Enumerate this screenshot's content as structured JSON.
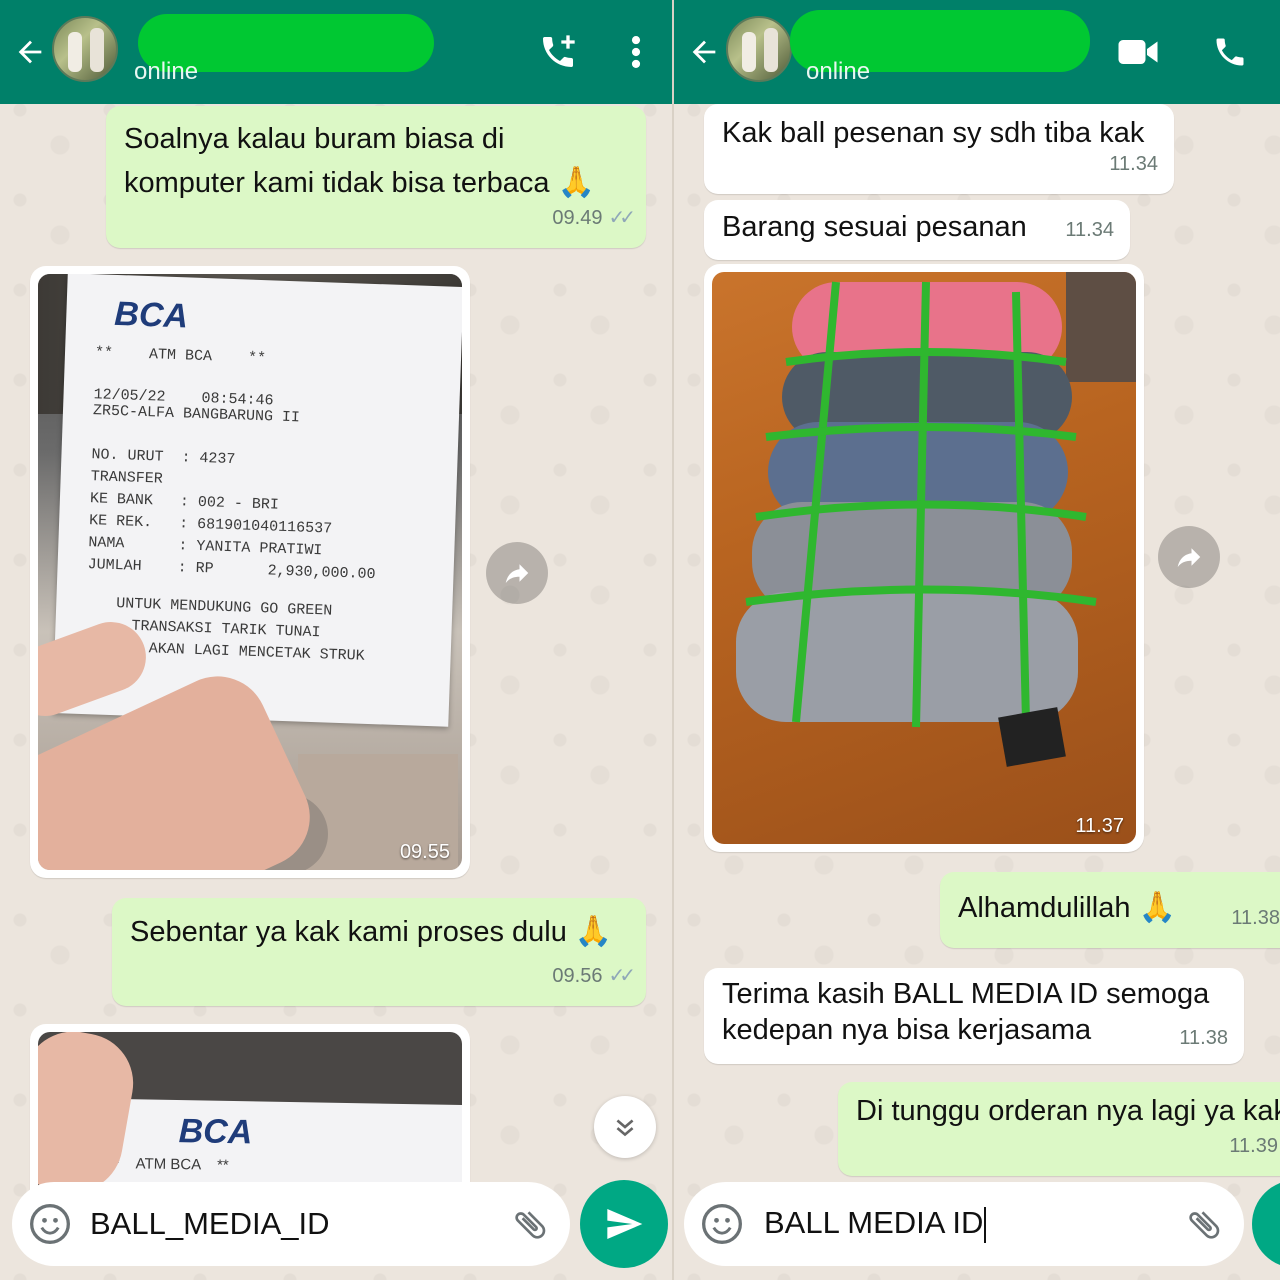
{
  "left": {
    "header": {
      "status": "online"
    },
    "messages": {
      "m1": {
        "text": "Soalnya kalau buram biasa di komputer kami tidak bisa terbaca",
        "emoji": "🙏",
        "time": "09.49"
      },
      "m2": {
        "time": "09.55"
      },
      "m3": {
        "text": "Sebentar ya kak kami proses dulu",
        "emoji": "🙏",
        "time": "09.56"
      }
    },
    "receipt": {
      "brand": "BCA",
      "lines": [
        "**    ATM BCA    **",
        "12/05/22    08:54:46",
        "ZR5C-ALFA BANGBARUNG II",
        "NO. URUT  : 4237",
        "TRANSFER",
        "KE BANK   : 002 - BRI",
        "KE REK.   : 681901040116537",
        "NAMA      : YANITA PRATIWI",
        "JUMLAH    : RP      2,930,000.00",
        "UNTUK MENDUKUNG GO GREEN",
        "TRANSAKSI TARIK TUNAI",
        "TIDAK AKAN LAGI MENCETAK STRUK"
      ]
    },
    "receipt2": {
      "brand": "BCA",
      "line": "**    ATM BCA    **"
    },
    "composer": {
      "text": "BALL_MEDIA_ID"
    }
  },
  "right": {
    "header": {
      "status": "online"
    },
    "messages": {
      "m1": {
        "text": "Kak ball pesenan sy sdh tiba kak",
        "time": "11.34"
      },
      "m2": {
        "text": "Barang sesuai pesanan",
        "time": "11.34"
      },
      "m3": {
        "time": "11.37"
      },
      "m4": {
        "text": "Alhamdulillah",
        "emoji": "🙏",
        "time": "11.38"
      },
      "m5": {
        "text": "Terima kasih BALL MEDIA ID semoga kedepan nya bisa kerjasama",
        "time": "11.38"
      },
      "m6": {
        "text": "Di tunggu orderan nya lagi ya kak",
        "time": "11.39"
      }
    },
    "composer": {
      "text": "BALL MEDIA ID"
    }
  },
  "colors": {
    "header": "#008069",
    "outgoing_bubble": "#dcf8c6",
    "incoming_bubble": "#ffffff",
    "send_button": "#00a884",
    "redaction": "#00c832"
  },
  "icons": {
    "back": "arrow-left-icon",
    "add_call": "add-call-icon",
    "menu": "more-vert-icon",
    "video": "video-call-icon",
    "call": "phone-icon",
    "emoji": "emoji-icon",
    "attach": "paperclip-icon",
    "send": "send-icon",
    "forward": "forward-icon",
    "scroll_down": "double-chevron-down-icon"
  }
}
